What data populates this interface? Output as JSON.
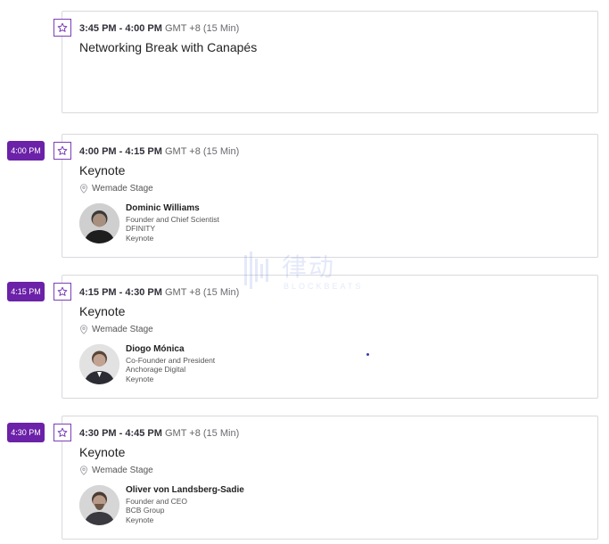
{
  "sessions": [
    {
      "pill": "",
      "time_range": "3:45 PM - 4:00 PM",
      "timezone": "GMT +8",
      "duration": "(15 Min)",
      "title": "Networking Break with Canapés"
    },
    {
      "pill": "4:00 PM",
      "time_range": "4:00 PM - 4:15 PM",
      "timezone": "GMT +8",
      "duration": "(15 Min)",
      "title": "Keynote",
      "stage": "Wemade Stage",
      "speaker": {
        "name": "Dominic Williams",
        "role": "Founder and Chief Scientist",
        "company": "DFINITY",
        "tag": "Keynote"
      }
    },
    {
      "pill": "4:15 PM",
      "time_range": "4:15 PM - 4:30 PM",
      "timezone": "GMT +8",
      "duration": "(15 Min)",
      "title": "Keynote",
      "stage": "Wemade Stage",
      "speaker": {
        "name": "Diogo Mónica",
        "role": "Co-Founder and President",
        "company": "Anchorage Digital",
        "tag": "Keynote"
      }
    },
    {
      "pill": "4:30 PM",
      "time_range": "4:30 PM - 4:45 PM",
      "timezone": "GMT +8",
      "duration": "(15 Min)",
      "title": "Keynote",
      "stage": "Wemade Stage",
      "speaker": {
        "name": "Oliver von Landsberg-Sadie",
        "role": "Founder and CEO",
        "company": "BCB Group",
        "tag": "Keynote"
      }
    }
  ],
  "icons": {
    "favorite": "star-outline-icon",
    "location": "map-pin-icon"
  },
  "colors": {
    "accent": "#6b21a8",
    "card_border": "#d9d9de"
  },
  "watermark": {
    "text_cn": "律动",
    "text_en": "BLOCKBEATS"
  }
}
